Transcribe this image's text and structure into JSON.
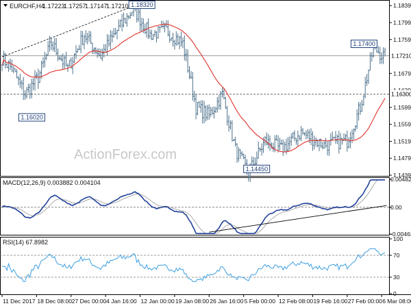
{
  "chart_data": [
    {
      "type": "candlestick",
      "header": {
        "symbol_line": "EURCHF,H4",
        "ohlc": [
          "1.17223",
          "1.17257",
          "1.17147",
          "1.17210"
        ]
      },
      "watermark": "ActionForex.com",
      "ylim": [
        1.1439,
        1.1849
      ],
      "y_ticks": [
        "1.18390",
        "1.17990",
        "1.17590",
        "1.17190",
        "1.16790",
        "1.16390",
        "1.15990",
        "1.15590",
        "1.15190",
        "1.14790",
        "1.14390"
      ],
      "y_tick_values": [
        1.1839,
        1.1799,
        1.1759,
        1.1719,
        1.1679,
        1.1639,
        1.1599,
        1.1559,
        1.1519,
        1.1479,
        1.1439
      ],
      "current_price_label": "1.17210",
      "current_price": 1.1721,
      "support_label": "1.16300",
      "support": 1.163,
      "annotations": [
        {
          "label": "1.18320",
          "value": 1.1832
        },
        {
          "label": "1.16020",
          "value": 1.1602
        },
        {
          "label": "1.14450",
          "value": 1.1445
        },
        {
          "label": "1.17400",
          "value": 1.174
        }
      ],
      "series_shape": {
        "price_color": "#4a6f8a",
        "ma_color": "#e0302a",
        "waypoints": [
          [
            0,
            1.1715
          ],
          [
            6,
            1.169
          ],
          [
            14,
            1.163
          ],
          [
            22,
            1.167
          ],
          [
            30,
            1.175
          ],
          [
            40,
            1.169
          ],
          [
            50,
            1.177
          ],
          [
            60,
            1.172
          ],
          [
            70,
            1.178
          ],
          [
            80,
            1.1832
          ],
          [
            90,
            1.177
          ],
          [
            100,
            1.178
          ],
          [
            110,
            1.175
          ],
          [
            118,
            1.16
          ],
          [
            126,
            1.158
          ],
          [
            134,
            1.163
          ],
          [
            142,
            1.15
          ],
          [
            150,
            1.1445
          ],
          [
            160,
            1.152
          ],
          [
            170,
            1.15
          ],
          [
            182,
            1.154
          ],
          [
            196,
            1.151
          ],
          [
            210,
            1.152
          ],
          [
            218,
            1.16
          ],
          [
            226,
            1.174
          ],
          [
            232,
            1.172
          ]
        ],
        "ma_period": 30
      }
    },
    {
      "type": "line",
      "label": "MACD(12,26,9) 0.003882 0.004104",
      "ylim": [
        -0.004632,
        0.004827
      ],
      "y_ticks": [
        "0.004827",
        "0.00",
        "-0.004632"
      ],
      "y_tick_values": [
        0.004827,
        0,
        -0.004632
      ],
      "macd_color": "#1f3f9a",
      "signal_color": "#aaaaaa",
      "trendline_color": "#000000"
    },
    {
      "type": "line",
      "label": "RSI(14) 67.8982",
      "ylim": [
        0,
        100
      ],
      "y_ticks": [
        "100",
        "70",
        "30",
        "0"
      ],
      "y_tick_values": [
        100,
        70,
        30,
        0
      ],
      "levels": [
        70,
        30
      ],
      "line_color": "#3a9ee0"
    }
  ],
  "x_axis": {
    "labels": [
      "11 Dec 2017",
      "18 Dec 08:00",
      "27 Dec 00:00",
      "4 Jan 16:00",
      "12 Jan 00:00",
      "19 Jan 08:00",
      "26 Jan 16:00",
      "5 Feb 00:00",
      "12 Feb 08:00",
      "19 Feb 16:00",
      "27 Feb 00:00",
      "6 Mar 08:00"
    ],
    "bar_index": [
      0,
      21,
      42,
      63,
      84,
      105,
      126,
      147,
      168,
      189,
      210,
      231
    ],
    "total_bars": 234
  }
}
